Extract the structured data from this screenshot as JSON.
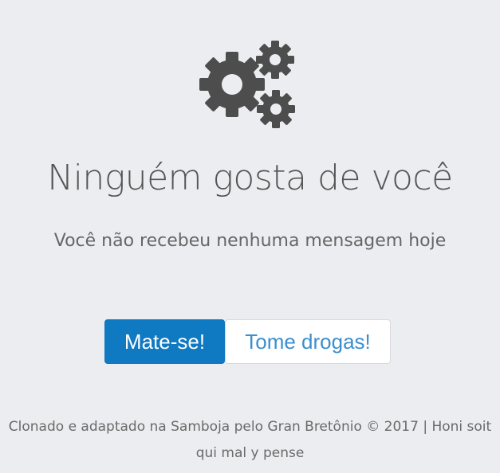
{
  "icon": {
    "name": "gears-icon",
    "color": "#4d4d4d"
  },
  "heading": "Ninguém gosta de você",
  "subheading": "Você não recebeu nenhuma mensagem hoje",
  "buttons": {
    "primary_label": "Mate-se!",
    "secondary_label": "Tome drogas!"
  },
  "footer": {
    "line1": "Clonado e adaptado na Samboja pelo Gran Bretônio © 2017 | Honi soit",
    "line2": "qui mal y pense"
  },
  "colors": {
    "background": "#ebedf0",
    "accent": "#0f79c1",
    "link": "#3a8fce"
  }
}
